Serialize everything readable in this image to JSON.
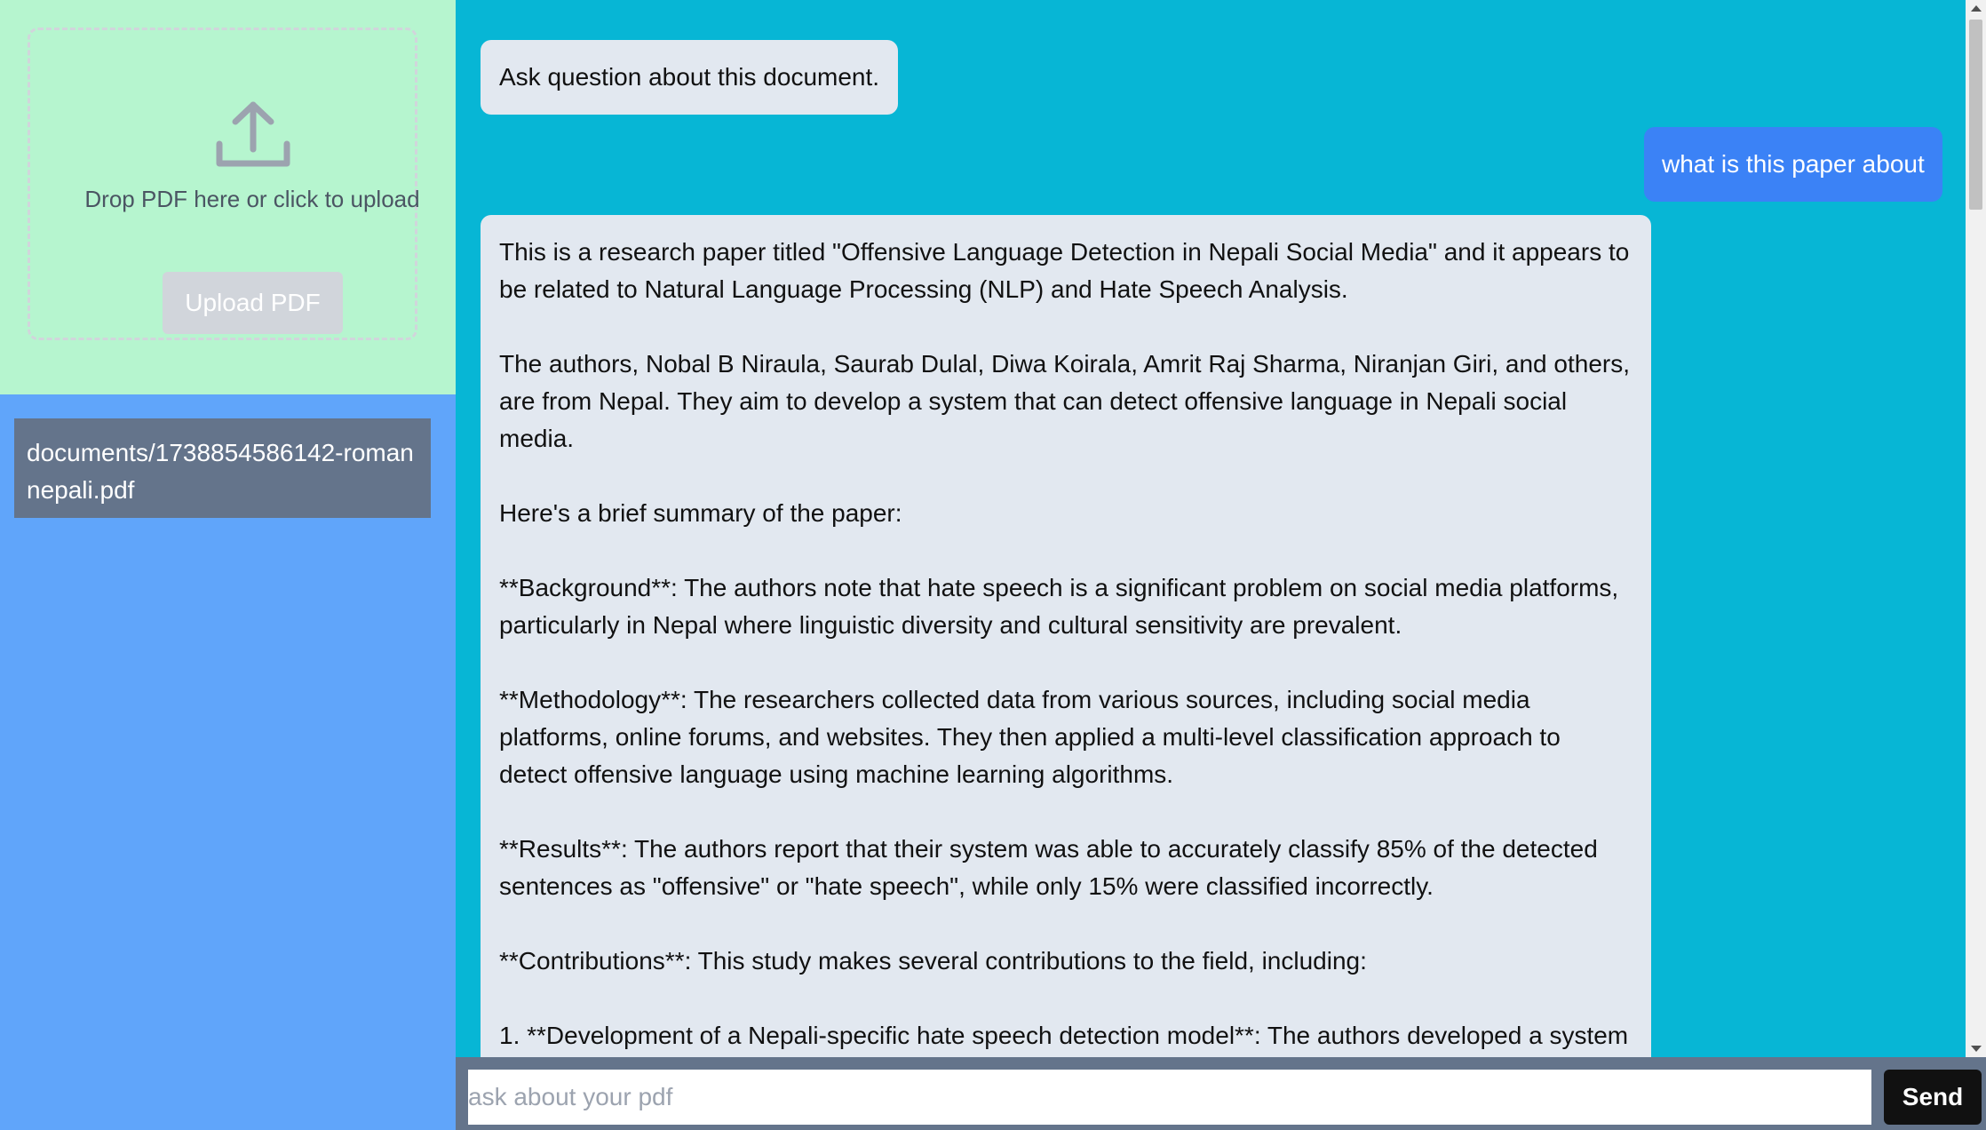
{
  "upload": {
    "icon": "upload-icon",
    "drop_text": "Drop PDF here or click to upload",
    "button_label": "Upload PDF"
  },
  "documents": [
    {
      "name": "documents/1738854586142-roman nepali.pdf"
    }
  ],
  "chat": {
    "messages": [
      {
        "role": "system",
        "text": "Ask question about this document."
      },
      {
        "role": "user",
        "text": "what is this paper about"
      },
      {
        "role": "assistant",
        "paragraphs": [
          "This is a research paper titled \"Offensive Language Detection in Nepali Social Media\" and it appears to be related to Natural Language Processing (NLP) and Hate Speech Analysis.",
          "The authors, Nobal B Niraula, Saurab Dulal, Diwa Koirala, Amrit Raj Sharma, Niranjan Giri, and others, are from Nepal. They aim to develop a system that can detect offensive language in Nepali social media.",
          "Here's a brief summary of the paper:",
          "**Background**: The authors note that hate speech is a significant problem on social media platforms, particularly in Nepal where linguistic diversity and cultural sensitivity are prevalent.",
          "**Methodology**: The researchers collected data from various sources, including social media platforms, online forums, and websites. They then applied a multi-level classification approach to detect offensive language using machine learning algorithms.",
          "**Results**: The authors report that their system was able to accurately classify 85% of the detected sentences as \"offensive\" or \"hate speech\", while only 15% were classified incorrectly.",
          "**Contributions**: This study makes several contributions to the field, including:",
          "1. **Development of a Nepali-specific hate speech detection model**: The authors developed a system"
        ]
      }
    ]
  },
  "input": {
    "placeholder": "ask about your pdf",
    "value": "",
    "send_label": "Send"
  },
  "colors": {
    "upload_bg": "#b6f5cf",
    "sidebar_bg": "#60a5fa",
    "doc_item_bg": "#64748b",
    "chat_bg": "#07b6d5",
    "user_bubble": "#3b82f6",
    "bot_bubble": "#e2e8f0",
    "send_button": "#111111"
  }
}
